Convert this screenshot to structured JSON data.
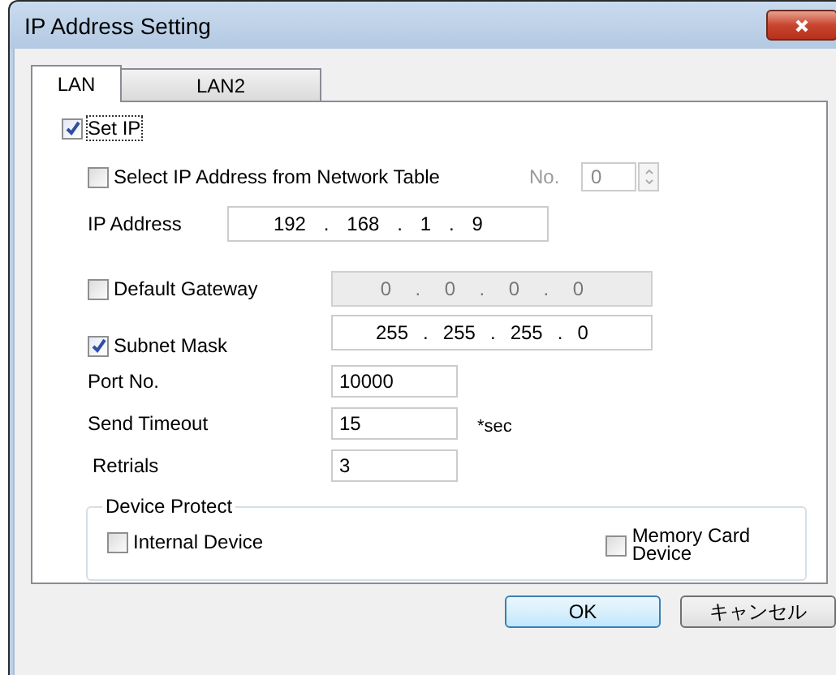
{
  "window": {
    "title": "IP Address Setting"
  },
  "tabs": [
    {
      "label": "LAN",
      "selected": true
    },
    {
      "label": "LAN2",
      "selected": false
    }
  ],
  "set_ip": {
    "label": "Set IP",
    "checked": true
  },
  "network_table": {
    "label": "Select IP Address from Network Table",
    "checked": false,
    "no_label": "No.",
    "no_value": "0",
    "disabled": true
  },
  "ip_address": {
    "label": "IP Address",
    "parts": [
      "192",
      ".",
      "168",
      ".",
      "1",
      ".",
      "9"
    ]
  },
  "default_gateway": {
    "label": "Default Gateway",
    "checked": false,
    "disabled": true,
    "parts": [
      "0",
      ".",
      "0",
      ".",
      "0",
      ".",
      "0"
    ]
  },
  "subnet_mask": {
    "label": "Subnet Mask",
    "checked": true,
    "disabled": false,
    "parts": [
      "255",
      ".",
      "255",
      ".",
      "255",
      ".",
      "0"
    ]
  },
  "fields": [
    {
      "label": "Port No.",
      "value": "10000"
    },
    {
      "label": "Send Timeout",
      "value": "15",
      "unit": "*sec"
    },
    {
      "label": "Retrials",
      "value": "3"
    }
  ],
  "device_protect": {
    "legend": "Device Protect",
    "items": [
      {
        "label": "Internal Device",
        "checked": false
      },
      {
        "label": "Memory Card\nDevice",
        "checked": false
      }
    ]
  },
  "buttons": [
    {
      "label": "OK",
      "default": true
    },
    {
      "label": "キャンセル",
      "default": false
    }
  ]
}
